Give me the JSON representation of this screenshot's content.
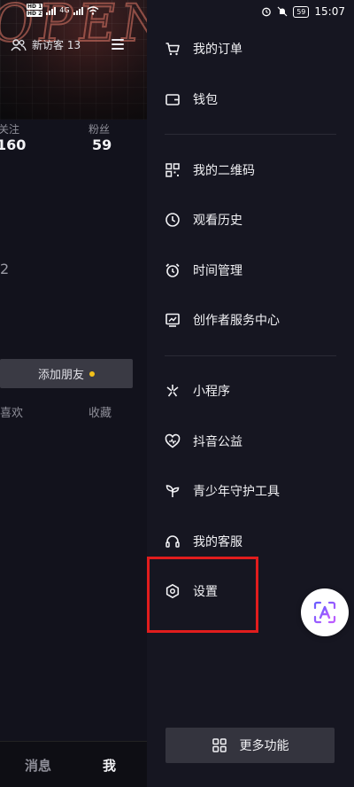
{
  "status_bar": {
    "sim1": "HD 1",
    "sim2": "HD 2",
    "network": "4G",
    "battery": "59",
    "time": "15:07"
  },
  "profile": {
    "new_visitors": "新访客 13",
    "following_label": "关注",
    "following_value": "160",
    "followers_label": "粉丝",
    "followers_value": "59",
    "fragment": "2",
    "add_friend": "添加朋友",
    "tab_likes": "喜欢",
    "tab_favorites": "收藏"
  },
  "bottom_nav": {
    "messages": "消息",
    "me": "我"
  },
  "drawer": {
    "items": [
      {
        "label": "我的订单",
        "icon": "cart-icon"
      },
      {
        "label": "钱包",
        "icon": "wallet-icon"
      },
      {
        "label": "我的二维码",
        "icon": "qr-code-icon"
      },
      {
        "label": "观看历史",
        "icon": "clock-icon"
      },
      {
        "label": "时间管理",
        "icon": "alarm-icon"
      },
      {
        "label": "创作者服务中心",
        "icon": "chart-icon"
      },
      {
        "label": "小程序",
        "icon": "mini-program-icon"
      },
      {
        "label": "抖音公益",
        "icon": "heart-icon"
      },
      {
        "label": "青少年守护工具",
        "icon": "sprout-icon"
      },
      {
        "label": "我的客服",
        "icon": "headset-icon"
      },
      {
        "label": "设置",
        "icon": "hexagon-icon"
      }
    ],
    "more": "更多功能"
  },
  "colors": {
    "drawer_bg": "#161621",
    "highlight": "#e11d1d",
    "accent_dot": "#f2c11a"
  }
}
